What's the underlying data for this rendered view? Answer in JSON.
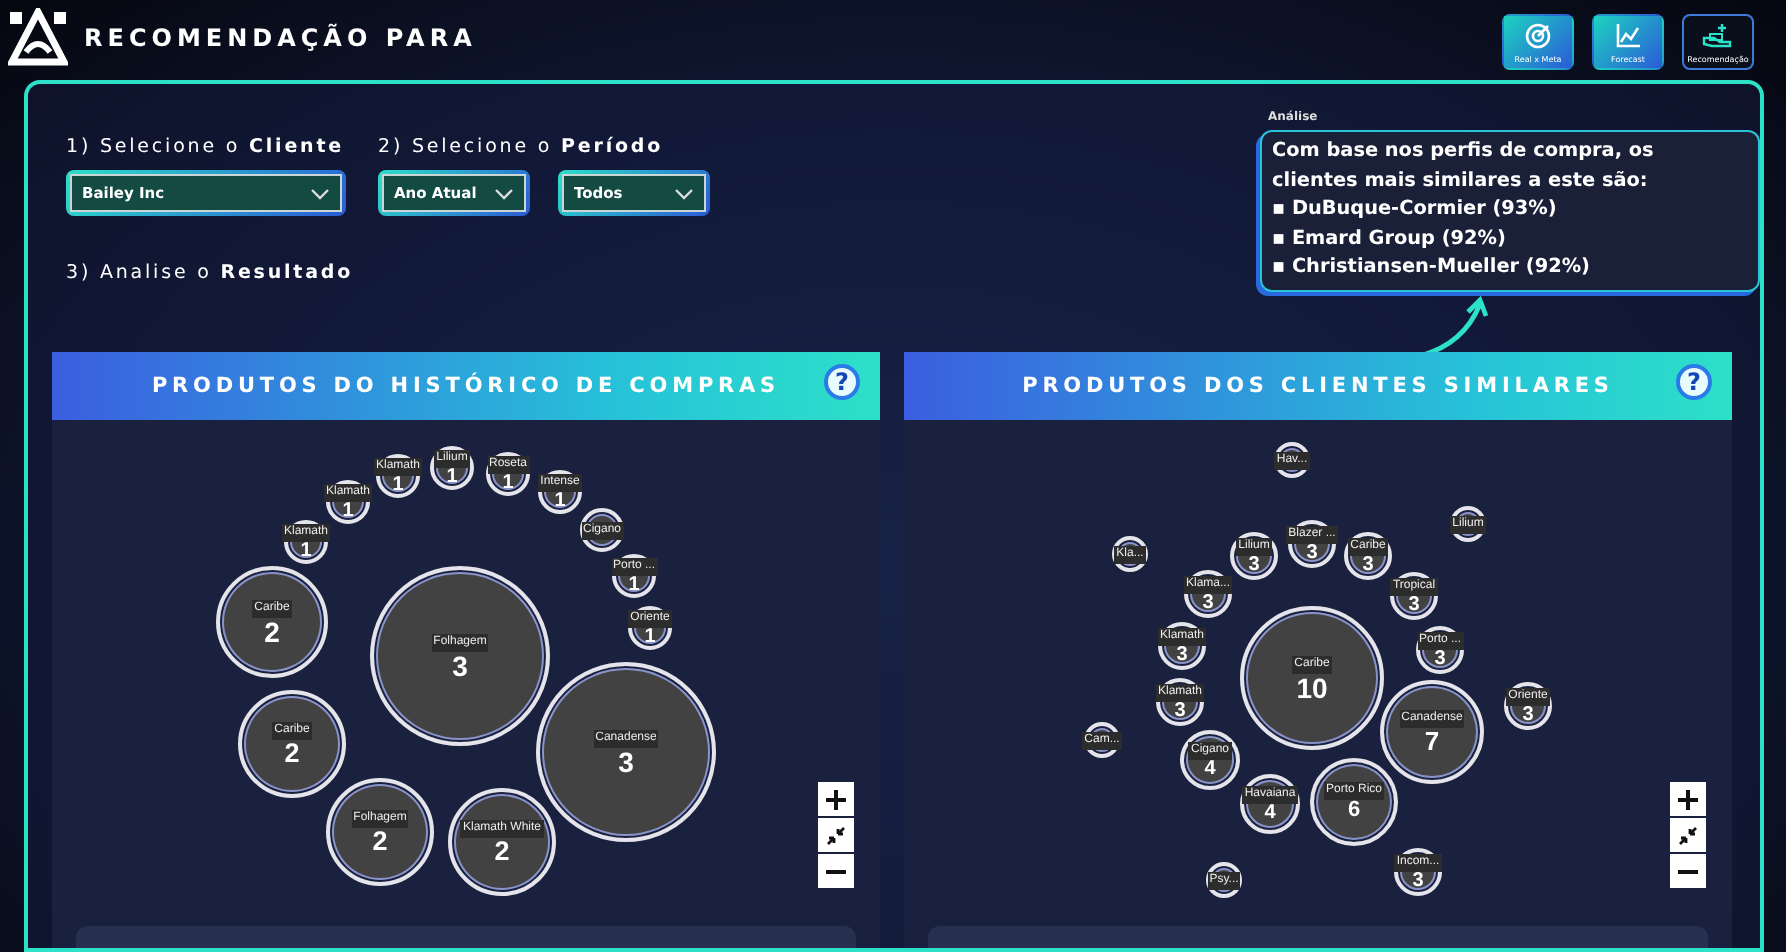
{
  "header": {
    "title": "RECOMENDAÇÃO PARA",
    "nav_buttons": [
      {
        "label": "Real x Meta",
        "kind": "target",
        "selected": false
      },
      {
        "label": "Forecast",
        "kind": "chart",
        "selected": false
      },
      {
        "label": "Recomendação",
        "kind": "recommend",
        "selected": true
      }
    ]
  },
  "steps": [
    "1) Selecione o **Cliente**",
    "2) Selecione o **Período**",
    "3) Analise o **Resultado**"
  ],
  "client_select": {
    "value": "Bailey Inc"
  },
  "period_selects": [
    {
      "value": "Ano Atual"
    },
    {
      "value": "Todos"
    }
  ],
  "analysis": {
    "label": "Análise",
    "intro": "Com base nos perfis de compra, os clientes mais similares a este são:",
    "items": [
      "▪ DuBuque-Cormier (93%)",
      "▪ Emard Group (92%)",
      "▪ Christiansen-Mueller (92%)"
    ]
  },
  "panels": [
    {
      "title": "PRODUTOS DO HISTÓRICO DE COMPRAS",
      "help": "?",
      "bubbles": [
        {
          "label": "Klamath",
          "value": "1"
        },
        {
          "label": "Klamath",
          "value": "1"
        },
        {
          "label": "Lilium",
          "value": "1"
        },
        {
          "label": "Roseta",
          "value": "1"
        },
        {
          "label": "Intense",
          "value": "1"
        },
        {
          "label": "Klamath",
          "value": "1"
        },
        {
          "label": "Cigano"
        },
        {
          "label": "Porto ...",
          "value": "1"
        },
        {
          "label": "Caribe",
          "value": "2"
        },
        {
          "label": "Folhagem",
          "value": "3"
        },
        {
          "label": "Oriente",
          "value": "1"
        },
        {
          "label": "Caribe",
          "value": "2"
        },
        {
          "label": "Canadense",
          "value": "3"
        },
        {
          "label": "Folhagem",
          "value": "2"
        },
        {
          "label": "Klamath White",
          "value": "2"
        }
      ]
    },
    {
      "title": "PRODUTOS DOS CLIENTES SIMILARES",
      "help": "?",
      "bubbles": [
        {
          "label": "Hav..."
        },
        {
          "label": "Kla..."
        },
        {
          "label": "Lilium",
          "value": "3"
        },
        {
          "label": "Blazer ...",
          "value": "3"
        },
        {
          "label": "Caribe",
          "value": "3"
        },
        {
          "label": "Lilium"
        },
        {
          "label": "Klama...",
          "value": "3"
        },
        {
          "label": "Tropical",
          "value": "3"
        },
        {
          "label": "Klamath",
          "value": "3"
        },
        {
          "label": "Caribe",
          "value": "10"
        },
        {
          "label": "Porto ...",
          "value": "3"
        },
        {
          "label": "Cam..."
        },
        {
          "label": "Klamath",
          "value": "3"
        },
        {
          "label": "Canadense",
          "value": "7"
        },
        {
          "label": "Oriente",
          "value": "3"
        },
        {
          "label": "Cigano",
          "value": "4"
        },
        {
          "label": "Havaiana",
          "value": "4"
        },
        {
          "label": "Porto Rico",
          "value": "6"
        },
        {
          "label": "Psy..."
        },
        {
          "label": "Incom...",
          "value": "3"
        }
      ]
    }
  ]
}
